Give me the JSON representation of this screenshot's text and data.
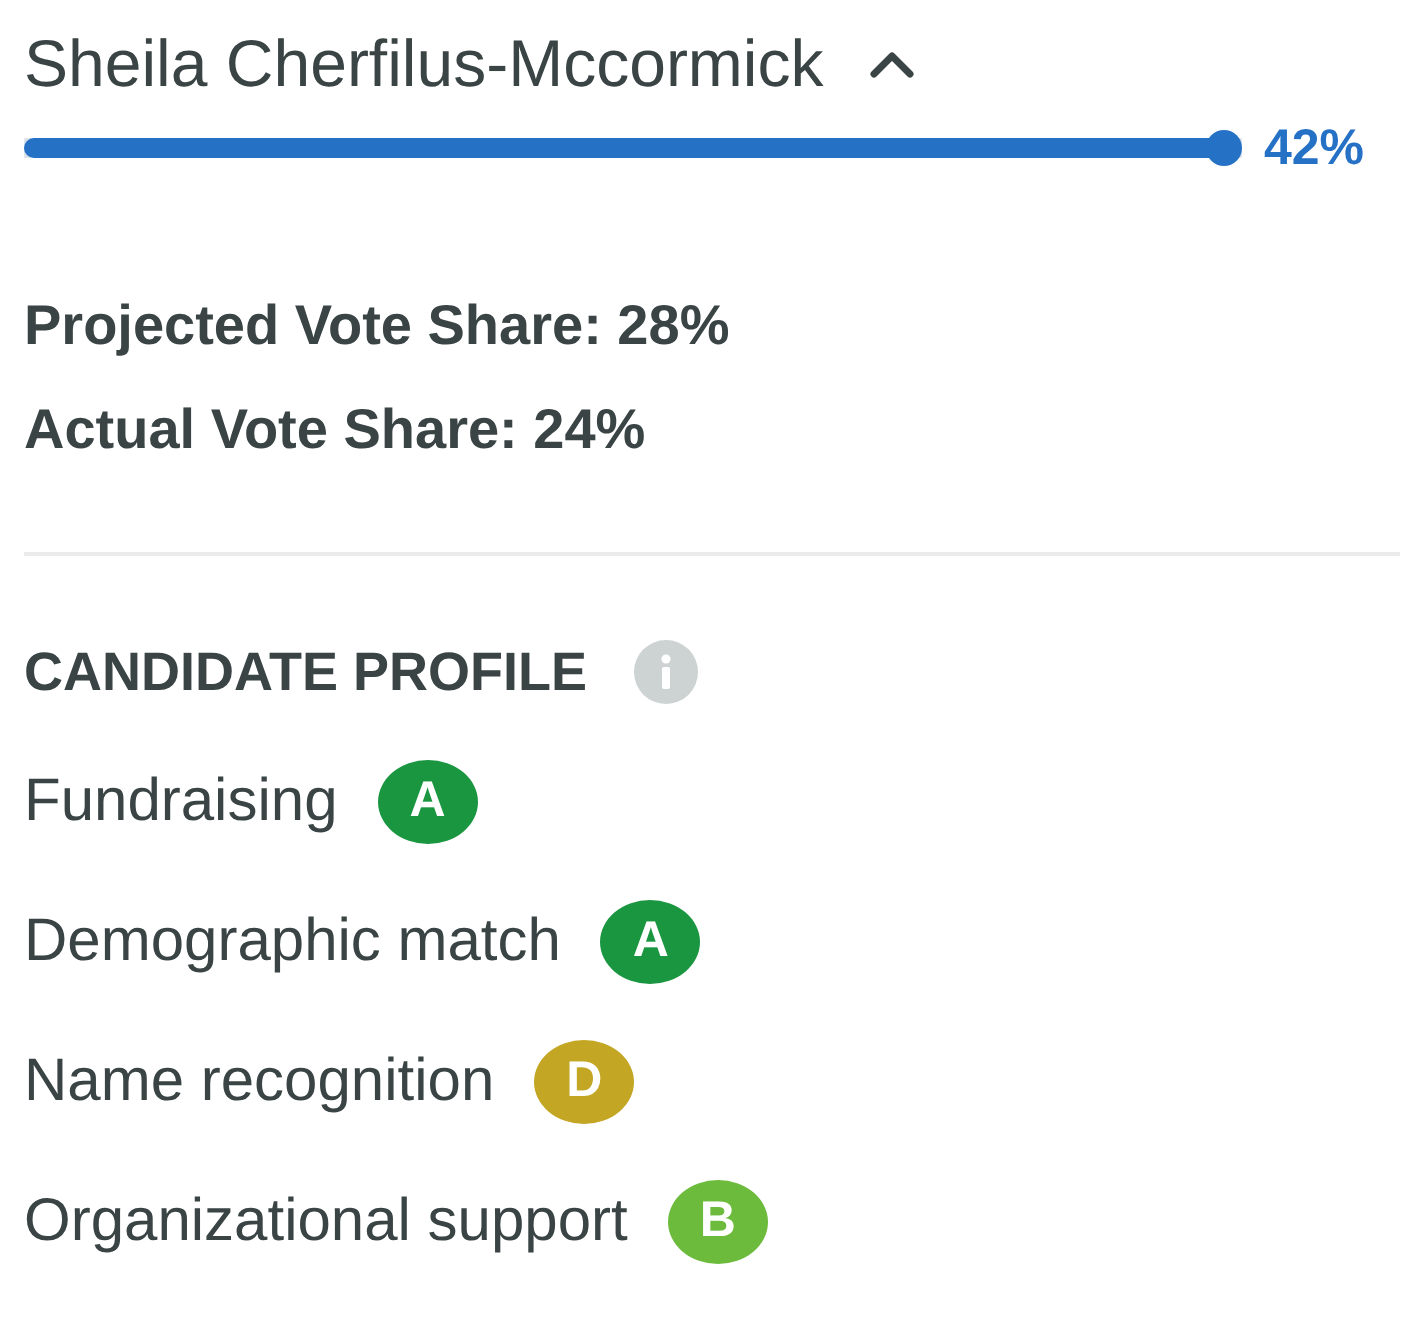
{
  "candidate": {
    "name": "Sheila Cherfilus-Mccormick",
    "expanded": true,
    "level": 1,
    "reading": "42%"
  },
  "vote_shares": [
    "Projected Vote Share: 28%",
    "Actual Vote Share: 24%"
  ],
  "profile": {
    "title": "CANDIDATE PROFILE",
    "items": [
      {
        "label": "Fundraising",
        "grade": "A",
        "color": "#1a9641"
      },
      {
        "label": "Demographic match",
        "grade": "A",
        "color": "#1a9641"
      },
      {
        "label": "Name recognition",
        "grade": "D",
        "color": "#c3a623"
      },
      {
        "label": "Organizational support",
        "grade": "B",
        "color": "#6cbb3c"
      }
    ]
  }
}
